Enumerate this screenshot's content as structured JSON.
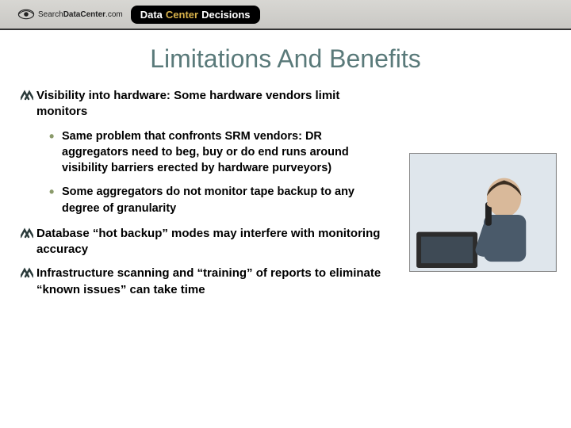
{
  "header": {
    "logo1_prefix": "Search",
    "logo1_mid": "DataCenter",
    "logo1_suffix": ".com",
    "badge_left": "Data",
    "badge_center": "Center",
    "badge_right": "Decisions"
  },
  "title": "Limitations And Benefits",
  "bullets": [
    {
      "text": "Visibility into hardware:  Some hardware vendors limit monitors",
      "subs": [
        "Same problem that confronts SRM vendors:  DR aggregators need to beg, buy or do end runs around visibility barriers erected by hardware purveyors)",
        "Some aggregators do not monitor tape backup to any degree of granularity"
      ]
    },
    {
      "text": "Database “hot backup” modes may interfere with monitoring accuracy",
      "subs": []
    },
    {
      "text": "Infrastructure scanning and “training” of reports to eliminate “known issues” can take time",
      "subs": []
    }
  ]
}
